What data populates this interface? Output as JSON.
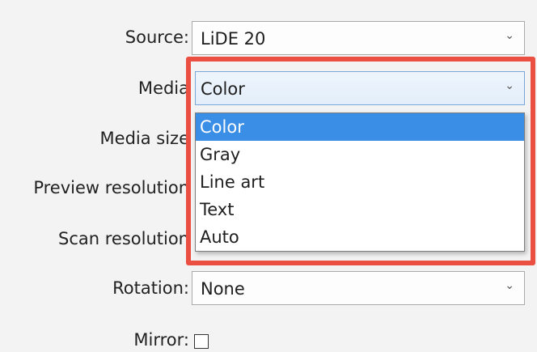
{
  "fields": {
    "source": {
      "label": "Source:",
      "value": "LiDE 20"
    },
    "media": {
      "label": "Media",
      "value": "Color"
    },
    "media_size": {
      "label": "Media size"
    },
    "preview_resolution": {
      "label": "Preview resolution"
    },
    "scan_resolution": {
      "label": "Scan resolution"
    },
    "rotation": {
      "label": "Rotation:",
      "value": "None"
    },
    "mirror": {
      "label": "Mirror:",
      "checked": false
    }
  },
  "media_dropdown": {
    "options": [
      "Color",
      "Gray",
      "Line art",
      "Text",
      "Auto"
    ],
    "selected": "Color"
  },
  "icons": {
    "chevron": "chevron-down-icon"
  },
  "colors": {
    "highlight": "#ea4f42",
    "selection": "#3a8ee6"
  }
}
